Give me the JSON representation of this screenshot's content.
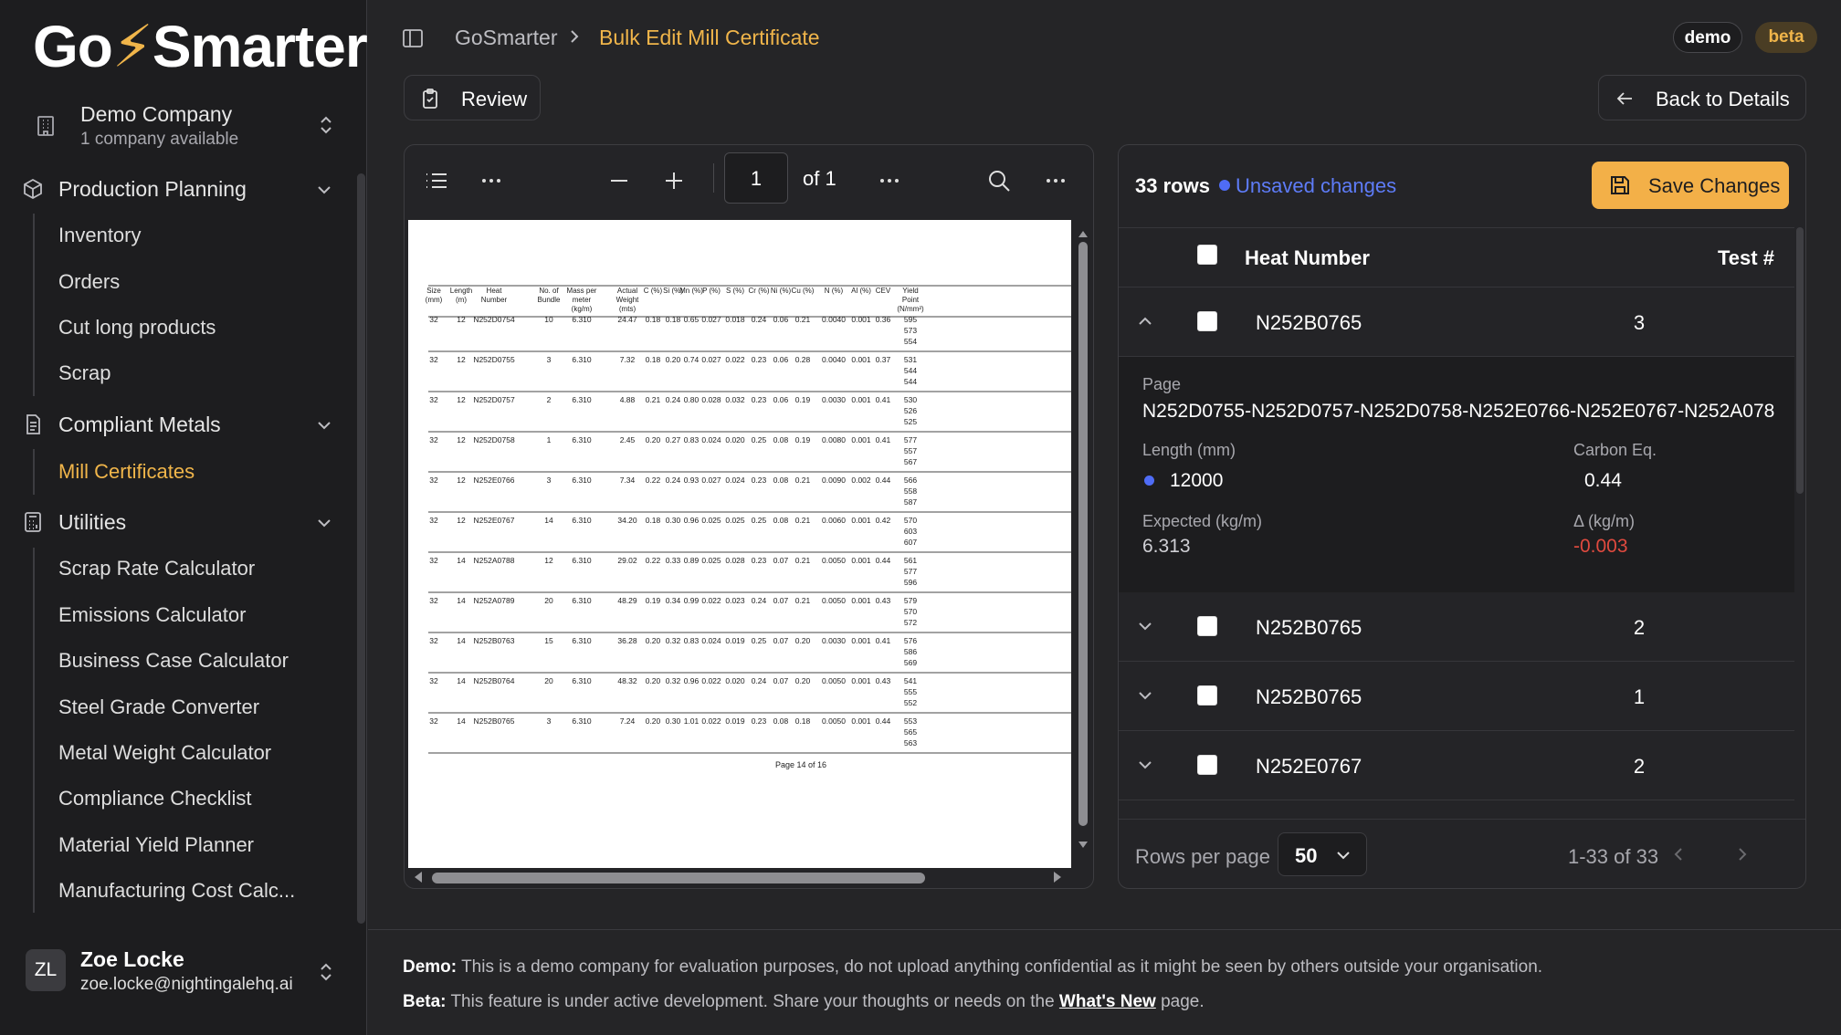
{
  "brand": {
    "logo_pre": "Go",
    "logo_post": "Smarter"
  },
  "company": {
    "name": "Demo Company",
    "subtitle": "1 company available"
  },
  "sidebar": {
    "groups": [
      {
        "label": "Production Planning",
        "items": [
          "Inventory",
          "Orders",
          "Cut long products",
          "Scrap"
        ]
      },
      {
        "label": "Compliant Metals",
        "items": [
          "Mill Certificates"
        ]
      },
      {
        "label": "Utilities",
        "items": [
          "Scrap Rate Calculator",
          "Emissions Calculator",
          "Business Case Calculator",
          "Steel Grade Converter",
          "Metal Weight Calculator",
          "Compliance Checklist",
          "Material Yield Planner",
          "Manufacturing Cost Calc..."
        ]
      }
    ],
    "active_item": "Mill Certificates"
  },
  "user": {
    "initials": "ZL",
    "name": "Zoe Locke",
    "email": "zoe.locke@nightingalehq.ai"
  },
  "breadcrumb": {
    "root": "GoSmarter",
    "current": "Bulk Edit Mill Certificate"
  },
  "badges": {
    "demo": "demo",
    "beta": "beta"
  },
  "buttons": {
    "review": "Review",
    "back": "Back to Details",
    "save": "Save Changes"
  },
  "pdf_viewer": {
    "page_number": "1",
    "page_total": "of 1",
    "doc_footer": "Page 14 of 16",
    "columns": [
      "Size (mm)",
      "Length (m)",
      "Heat Number",
      "No. of Bundle",
      "Mass per meter (kg/m)",
      "Actual Weight (mts)",
      "C (%)",
      "Si (%)",
      "Mn (%)",
      "P (%)",
      "S (%)",
      "Cr (%)",
      "Ni (%)",
      "Cu (%)",
      "N (%)",
      "Al (%)",
      "CEV",
      "Yield Point (N/mm²)"
    ],
    "rows": [
      [
        "32",
        "12",
        "N252D0754",
        "10",
        "6.310",
        "24.47",
        "0.18",
        "0.18",
        "0.65",
        "0.027",
        "0.018",
        "0.24",
        "0.06",
        "0.21",
        "0.0040",
        "0.001",
        "0.36",
        [
          "595",
          "573",
          "554"
        ]
      ],
      [
        "32",
        "12",
        "N252D0755",
        "3",
        "6.310",
        "7.32",
        "0.18",
        "0.20",
        "0.74",
        "0.027",
        "0.022",
        "0.23",
        "0.06",
        "0.28",
        "0.0040",
        "0.001",
        "0.37",
        [
          "531",
          "544",
          "544"
        ]
      ],
      [
        "32",
        "12",
        "N252D0757",
        "2",
        "6.310",
        "4.88",
        "0.21",
        "0.24",
        "0.80",
        "0.028",
        "0.032",
        "0.23",
        "0.06",
        "0.19",
        "0.0030",
        "0.001",
        "0.41",
        [
          "530",
          "526",
          "525"
        ]
      ],
      [
        "32",
        "12",
        "N252D0758",
        "1",
        "6.310",
        "2.45",
        "0.20",
        "0.27",
        "0.83",
        "0.024",
        "0.020",
        "0.25",
        "0.08",
        "0.19",
        "0.0080",
        "0.001",
        "0.41",
        [
          "577",
          "557",
          "567"
        ]
      ],
      [
        "32",
        "12",
        "N252E0766",
        "3",
        "6.310",
        "7.34",
        "0.22",
        "0.24",
        "0.93",
        "0.027",
        "0.024",
        "0.23",
        "0.08",
        "0.21",
        "0.0090",
        "0.002",
        "0.44",
        [
          "566",
          "558",
          "587"
        ]
      ],
      [
        "32",
        "12",
        "N252E0767",
        "14",
        "6.310",
        "34.20",
        "0.18",
        "0.30",
        "0.96",
        "0.025",
        "0.025",
        "0.25",
        "0.08",
        "0.21",
        "0.0060",
        "0.001",
        "0.42",
        [
          "570",
          "603",
          "607"
        ]
      ],
      [
        "32",
        "14",
        "N252A0788",
        "12",
        "6.310",
        "29.02",
        "0.22",
        "0.33",
        "0.89",
        "0.025",
        "0.028",
        "0.23",
        "0.07",
        "0.21",
        "0.0050",
        "0.001",
        "0.44",
        [
          "561",
          "577",
          "596"
        ]
      ],
      [
        "32",
        "14",
        "N252A0789",
        "20",
        "6.310",
        "48.29",
        "0.19",
        "0.34",
        "0.99",
        "0.022",
        "0.023",
        "0.24",
        "0.07",
        "0.21",
        "0.0050",
        "0.001",
        "0.43",
        [
          "579",
          "570",
          "572"
        ]
      ],
      [
        "32",
        "14",
        "N252B0763",
        "15",
        "6.310",
        "36.28",
        "0.20",
        "0.32",
        "0.83",
        "0.024",
        "0.019",
        "0.25",
        "0.07",
        "0.20",
        "0.0030",
        "0.001",
        "0.41",
        [
          "576",
          "586",
          "569"
        ]
      ],
      [
        "32",
        "14",
        "N252B0764",
        "20",
        "6.310",
        "48.32",
        "0.20",
        "0.32",
        "0.96",
        "0.022",
        "0.020",
        "0.24",
        "0.07",
        "0.20",
        "0.0050",
        "0.001",
        "0.43",
        [
          "541",
          "555",
          "552"
        ]
      ],
      [
        "32",
        "14",
        "N252B0765",
        "3",
        "6.310",
        "7.24",
        "0.20",
        "0.30",
        "1.01",
        "0.022",
        "0.019",
        "0.23",
        "0.08",
        "0.18",
        "0.0050",
        "0.001",
        "0.44",
        [
          "553",
          "565",
          "563"
        ]
      ]
    ]
  },
  "table_panel": {
    "row_count": "33 rows",
    "unsaved": "Unsaved changes",
    "headers": {
      "heat": "Heat Number",
      "test": "Test #"
    },
    "rows": [
      {
        "heat": "N252B0765",
        "test": "3",
        "expanded": true
      },
      {
        "heat": "N252B0765",
        "test": "2",
        "expanded": false
      },
      {
        "heat": "N252B0765",
        "test": "1",
        "expanded": false
      },
      {
        "heat": "N252E0767",
        "test": "2",
        "expanded": false
      }
    ],
    "detail": {
      "page_label": "Page",
      "page_value": "N252D0755-N252D0757-N252D0758-N252E0766-N252E0767-N252A078",
      "length_label": "Length (mm)",
      "length_value": "12000",
      "carbon_label": "Carbon Eq.",
      "carbon_value": "0.44",
      "expected_label": "Expected (kg/m)",
      "expected_value": "6.313",
      "delta_label": "Δ (kg/m)",
      "delta_value": "-0.003"
    },
    "footer": {
      "rows_per_page_label": "Rows per page",
      "rows_per_page": "50",
      "range": "1-33 of 33"
    }
  },
  "page_footer": {
    "demo_label": "Demo:",
    "demo_text": "This is a demo company for evaluation purposes, do not upload anything confidential as it might be seen by others outside your organisation.",
    "beta_label": "Beta:",
    "beta_text": "This feature is under active development. Share your thoughts or needs on the",
    "beta_link": "What's New",
    "beta_tail": "page."
  },
  "colors": {
    "accent": "#f0b54a",
    "unsaved": "#5e7cf8",
    "negative": "#e04a3f",
    "bg": "#252527",
    "sidebar": "#1d1d1f"
  },
  "icons": [
    "building-icon",
    "chevron-up-down-icon",
    "cube-icon",
    "document-icon",
    "calculator-icon",
    "chevron-down-icon",
    "sidebar-toggle-icon",
    "chevron-right-icon",
    "clipboard-check-icon",
    "arrow-left-icon",
    "list-icon",
    "more-icon",
    "minus-icon",
    "plus-icon",
    "search-icon",
    "floppy-disk-icon",
    "chevron-up-icon",
    "chevron-left-icon"
  ]
}
